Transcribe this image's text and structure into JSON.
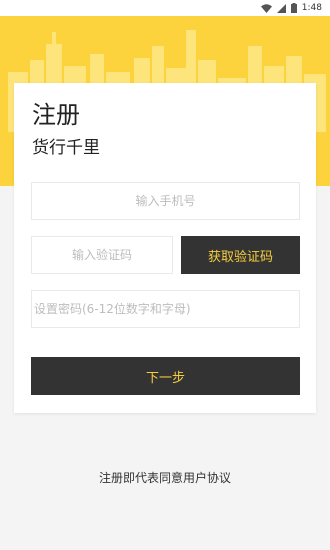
{
  "status_bar": {
    "time": "1:48",
    "icons": [
      "wifi-icon",
      "signal-icon",
      "battery-icon"
    ]
  },
  "colors": {
    "hero_yellow": "#fcd23d",
    "skyline_yellow": "#fde57b",
    "dark_button": "#333333",
    "button_text": "#f7cf3c",
    "background": "#f4f4f4"
  },
  "register": {
    "title": "注册",
    "subtitle": "货行千里",
    "phone_placeholder": "输入手机号",
    "code_placeholder": "输入验证码",
    "get_code_label": "获取验证码",
    "password_placeholder": "设置密码(6-12位数字和字母)",
    "next_label": "下一步"
  },
  "footer": {
    "agreement": "注册即代表同意用户协议"
  }
}
